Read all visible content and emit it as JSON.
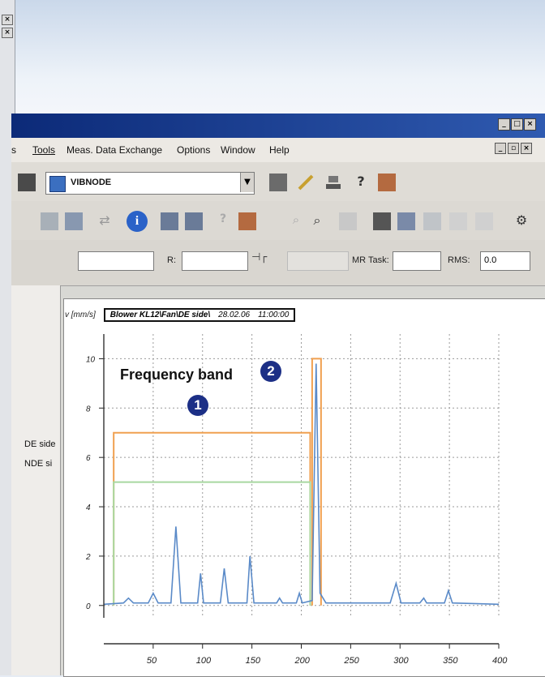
{
  "menu": {
    "items": [
      "Tools",
      "Meas. Data Exchange",
      "Options",
      "Window",
      "Help"
    ],
    "partial_left": "s"
  },
  "toolbar": {
    "node_label": "VIBNODE"
  },
  "status_fields": {
    "r_label": "R:",
    "mr_task_label": "MR Task:",
    "rms_label": "RMS:",
    "rms_value": "0.0"
  },
  "left_panel": {
    "items": [
      "DE side",
      "NDE si"
    ]
  },
  "chart_header": {
    "y_unit": "v [mm/s]",
    "measurement_point": "Blower KL12\\Fan\\DE side\\",
    "date": "28.02.06",
    "time": "11:00:00"
  },
  "annotations": {
    "frequency_band_label": "Frequency band",
    "marker_1": "1",
    "marker_2": "2"
  },
  "colors": {
    "title_bar": "#0c2a78",
    "spectrum_line": "#5a8ac8",
    "band_alarm": "#f0a050",
    "band_warning": "#a8d8a0",
    "marker_fill": "#1c2f86"
  },
  "chart_data": {
    "type": "line",
    "title": "",
    "xlabel": "",
    "ylabel": "v [mm/s]",
    "xlim": [
      0,
      400
    ],
    "ylim": [
      -0.5,
      11
    ],
    "x_ticks": [
      50,
      100,
      150,
      200,
      250,
      300,
      350,
      400
    ],
    "y_ticks": [
      0,
      2,
      4,
      6,
      8,
      10
    ],
    "grid": true,
    "series": [
      {
        "values_xy": [
          [
            0,
            0.05
          ],
          [
            20,
            0.1
          ],
          [
            25,
            0.3
          ],
          [
            30,
            0.1
          ],
          [
            45,
            0.1
          ],
          [
            50,
            0.5
          ],
          [
            55,
            0.1
          ],
          [
            68,
            0.1
          ],
          [
            73,
            3.2
          ],
          [
            78,
            0.1
          ],
          [
            95,
            0.1
          ],
          [
            98,
            1.3
          ],
          [
            101,
            0.1
          ],
          [
            118,
            0.1
          ],
          [
            122,
            1.5
          ],
          [
            126,
            0.1
          ],
          [
            145,
            0.1
          ],
          [
            148,
            2.0
          ],
          [
            152,
            0.1
          ],
          [
            175,
            0.1
          ],
          [
            178,
            0.3
          ],
          [
            181,
            0.1
          ],
          [
            195,
            0.1
          ],
          [
            198,
            0.5
          ],
          [
            201,
            0.1
          ],
          [
            211,
            0.2
          ],
          [
            215,
            9.8
          ],
          [
            219,
            0.5
          ],
          [
            225,
            0.1
          ],
          [
            290,
            0.1
          ],
          [
            296,
            0.9
          ],
          [
            301,
            0.1
          ],
          [
            320,
            0.1
          ],
          [
            324,
            0.3
          ],
          [
            327,
            0.1
          ],
          [
            345,
            0.1
          ],
          [
            349,
            0.6
          ],
          [
            353,
            0.1
          ],
          [
            400,
            0.05
          ]
        ]
      }
    ],
    "bands": [
      {
        "x": [
          10,
          209
        ],
        "y_upper": 7.0,
        "role": "alarm"
      },
      {
        "x": [
          10,
          209
        ],
        "y_upper": 5.0,
        "role": "warning"
      },
      {
        "x": [
          211,
          220
        ],
        "y_upper": 10.0,
        "role": "alarm"
      }
    ]
  }
}
